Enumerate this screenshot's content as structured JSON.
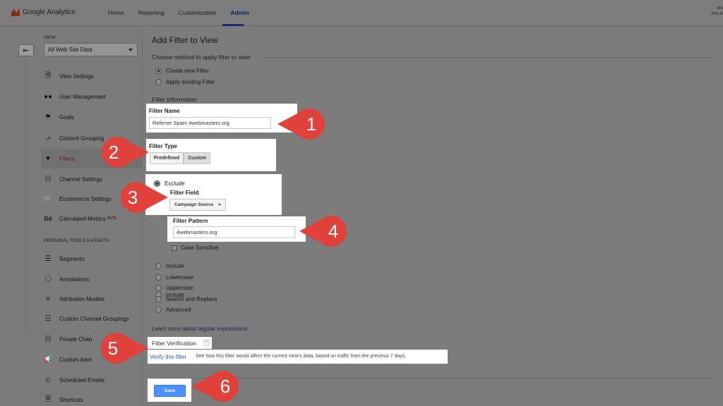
{
  "topbar": {
    "logo_text": "Google Analytics",
    "nav": [
      "Home",
      "Reporting",
      "Customization",
      "Admin"
    ],
    "active_nav": "Admin",
    "user_line1": "dro",
    "user_line2": "Arts H"
  },
  "sidebar": {
    "back_icon": "arrow-left-icon",
    "view_label": "VIEW",
    "view_select": "All Web Site Data",
    "items": [
      {
        "label": "View Settings",
        "icon": "document-icon"
      },
      {
        "label": "User Management",
        "icon": "users-icon"
      },
      {
        "label": "Goals",
        "icon": "flag-icon"
      },
      {
        "label": "Content Grouping",
        "icon": "hierarchy-icon"
      },
      {
        "label": "Filters",
        "icon": "filter-icon"
      },
      {
        "label": "Channel Settings",
        "icon": "channel-icon"
      },
      {
        "label": "Ecommerce Settings",
        "icon": "cart-icon"
      },
      {
        "label": "Calculated Metrics",
        "icon": "dd-icon",
        "badge": "BETA"
      }
    ],
    "section_head": "PERSONAL TOOLS & ASSETS",
    "tools": [
      {
        "label": "Segments",
        "icon": "segments-icon"
      },
      {
        "label": "Annotations",
        "icon": "annotation-icon"
      },
      {
        "label": "Attribution Models",
        "icon": "attribution-icon"
      },
      {
        "label": "Custom Channel Groupings",
        "icon": "channel-icon"
      },
      {
        "label": "Private Chan",
        "icon": "channel-icon"
      },
      {
        "label": "Custom Alert",
        "icon": "megaphone-icon"
      },
      {
        "label": "Scheduled Emails",
        "icon": "clock-icon"
      },
      {
        "label": "Shortcuts",
        "icon": "shortcut-icon"
      }
    ]
  },
  "main": {
    "title": "Add Filter to View",
    "method_heading": "Choose method to apply filter to view",
    "method_options": [
      "Create new Filter",
      "Apply existing Filter"
    ],
    "info_heading": "Filter Information",
    "filter_name_label": "Filter Name",
    "filter_name_value": "Referrer Spam 4webmasters.org",
    "filter_type_label": "Filter Type",
    "filter_type_options": [
      "Predefined",
      "Custom"
    ],
    "exclude_label": "Exclude",
    "filter_field_label": "Filter Field",
    "filter_field_value": "Campaign Source",
    "filter_pattern_label": "Filter Pattern",
    "filter_pattern_value": "4webmasters.org",
    "case_sensitive_label": "Case Sensitive",
    "other_options": [
      "Include",
      "Lowercase",
      "Uppercase",
      "Search and Replace",
      "Advanced"
    ],
    "learn_more": "Learn more about regular expressions",
    "verification_heading": "Filter Verification",
    "verify_link": "Verify this filter",
    "verify_desc": "See how this filter would affect the current view's data, based on traffic from the previous 7 days.",
    "save_label": "Save"
  },
  "callouts": [
    "1",
    "2",
    "3",
    "4",
    "5",
    "6"
  ],
  "colors": {
    "callout": "#e0413a",
    "save_button": "#4d90fe",
    "admin_underline": "#1a2878"
  }
}
